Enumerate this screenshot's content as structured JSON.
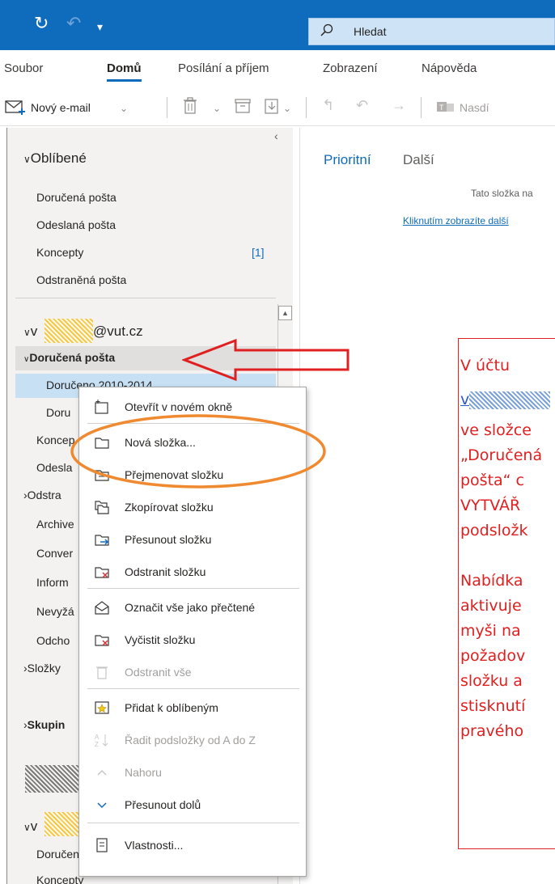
{
  "search": {
    "placeholder": "Hledat"
  },
  "menu": {
    "tabs": [
      {
        "label": "Soubor"
      },
      {
        "label": "Domů"
      },
      {
        "label": "Posílání a příjem"
      },
      {
        "label": "Zobrazení"
      },
      {
        "label": "Nápověda"
      }
    ]
  },
  "toolbar": {
    "new_email_label": "Nový e-mail",
    "share_label": "Nasdí"
  },
  "favorites": {
    "title": "Oblíbené",
    "items": [
      {
        "label": "Doručená pošta"
      },
      {
        "label": "Odeslaná pošta"
      },
      {
        "label": "Koncepty",
        "count": "[1]"
      },
      {
        "label": "Odstraněná pošta"
      }
    ]
  },
  "account1": {
    "prefix": "v",
    "domain": "@vut.cz",
    "inbox_label": "Doručená pošta",
    "items": [
      {
        "label": "Doručeno 2010-2014"
      },
      {
        "label": "Doru"
      },
      {
        "label": "Koncep"
      },
      {
        "label": "Odesla"
      },
      {
        "label": "Odstra"
      },
      {
        "label": "Archive"
      },
      {
        "label": "Conver"
      },
      {
        "label": "Inform"
      },
      {
        "label": "Nevyžá"
      },
      {
        "label": "Odcho"
      },
      {
        "label": "Složky"
      },
      {
        "label": "Skupin"
      }
    ]
  },
  "account2": {
    "prefix": "v",
    "items": [
      {
        "label": "Doručená pošta"
      },
      {
        "label": "Koncepty"
      }
    ]
  },
  "reading": {
    "tab_focused": "Prioritní",
    "tab_other": "Další",
    "info": "Tato složka na",
    "link": "Kliknutím zobrazíte další"
  },
  "context_menu": {
    "items": [
      {
        "label": "Otevřít v novém okně",
        "icon": "new-window-icon"
      },
      {
        "label": "Nová složka...",
        "icon": "new-folder-icon"
      },
      {
        "label": "Přejmenovat složku",
        "icon": "rename-folder-icon"
      },
      {
        "label": "Zkopírovat složku",
        "icon": "copy-folder-icon"
      },
      {
        "label": "Přesunout složku",
        "icon": "move-folder-icon"
      },
      {
        "label": "Odstranit složku",
        "icon": "delete-folder-icon"
      },
      {
        "label": "Označit vše jako přečtené",
        "icon": "mark-read-icon"
      },
      {
        "label": "Vyčistit složku",
        "icon": "clean-folder-icon"
      },
      {
        "label": "Odstranit vše",
        "icon": "delete-all-icon",
        "disabled": true
      },
      {
        "label": "Přidat k oblíbeným",
        "icon": "add-favorite-icon"
      },
      {
        "label": "Řadit podsložky od A do Z",
        "icon": "sort-az-icon",
        "disabled": true
      },
      {
        "label": "Nahoru",
        "icon": "move-up-icon",
        "disabled": true
      },
      {
        "label": "Přesunout dolů",
        "icon": "move-down-icon"
      },
      {
        "label": "Vlastnosti...",
        "icon": "properties-icon"
      }
    ]
  },
  "annotation": {
    "lines1": [
      "V účtu",
      "",
      "ve složce",
      "„Doručená",
      "pošta“ c",
      "VYTVÁŘ",
      "podsložk"
    ],
    "mail": "v",
    "lines2": [
      "Nabídka",
      "aktivuje",
      "myši na",
      "požadov",
      "složku a",
      "stisknutí",
      "pravého"
    ]
  },
  "colors": {
    "accent": "#0f6cbd",
    "annotation": "#e02020",
    "highlight": "#f08a30"
  }
}
